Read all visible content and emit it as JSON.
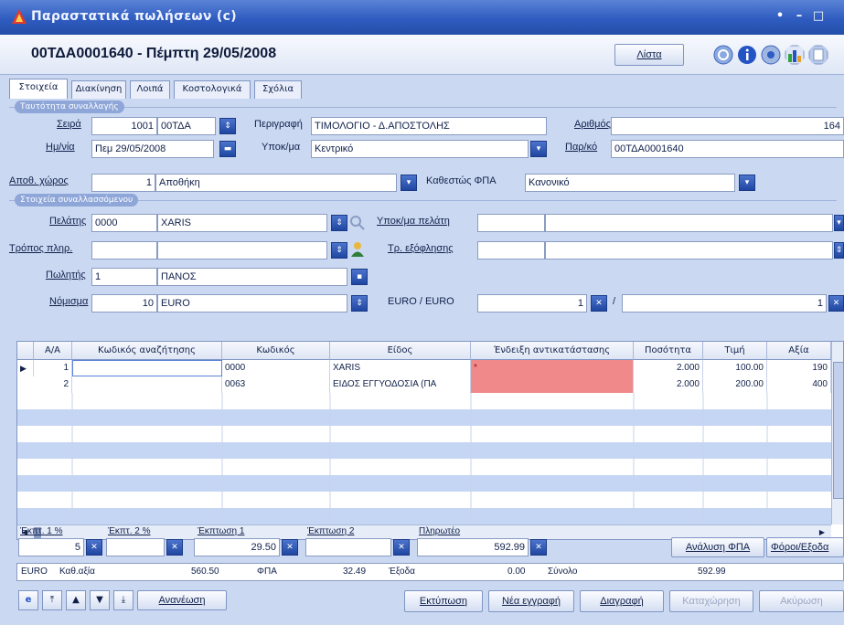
{
  "window": {
    "title": "Παραστατικά πωλήσεων (c)",
    "controls": [
      "•",
      "–",
      "□"
    ]
  },
  "header": {
    "doc_title": "00ΤΔΑ0001640 - Πέμπτη 29/05/2008",
    "list_button": "Λίστα",
    "toolbar_icons": [
      "refresh-icon",
      "info-icon",
      "settings-icon",
      "chart-icon",
      "help-icon"
    ]
  },
  "tabs": [
    {
      "label": "Στοιχεία",
      "active": true
    },
    {
      "label": "Διακίνηση",
      "active": false
    },
    {
      "label": "Λοιπά",
      "active": false
    },
    {
      "label": "Κοστολογικά",
      "active": false
    },
    {
      "label": "Σχόλια",
      "active": false
    }
  ],
  "transaction": {
    "group_label": "Ταυτότητα συναλλαγής",
    "series_label": "Σειρά",
    "series_code": "1001",
    "series_name": "00ΤΔΑ",
    "description_label": "Περιγραφή",
    "description_value": "ΤΙΜΟΛΟΓΙΟ - Δ.ΑΠΟΣΤΟΛΗΣ",
    "number_label": "Αριθμός",
    "number_value": "164",
    "date_label": "Ημ/νία",
    "date_value": "Πεμ 29/05/2008",
    "branch_label": "Υποκ/μα",
    "branch_value": "Κεντρικό",
    "docref_label": "Παρ/κό",
    "docref_value": "00ΤΔΑ0001640",
    "warehouse_label": "Αποθ. χώρος",
    "warehouse_code": "1",
    "warehouse_name": "Αποθήκη",
    "vat_label": "Καθεστώς ΦΠΑ",
    "vat_value": "Κανονικό"
  },
  "counterparty": {
    "group_label": "Στοιχεία συναλλασσόμενου",
    "customer_label": "Πελάτης",
    "customer_code": "0000",
    "customer_name": "XARIS",
    "customer_branch_label": "Υποκ/μα πελάτη",
    "customer_branch_value": "",
    "payment_label": "Τρόπος πληρ.",
    "payment_code": "",
    "payment_name": "",
    "settlement_label": "Τρ. εξόφλησης",
    "settlement_value": "",
    "seller_label": "Πωλητής",
    "seller_code": "1",
    "seller_name": "ΠΑΝΟΣ",
    "currency_label": "Νόμισμα",
    "currency_code": "10",
    "currency_name": "EURO",
    "rate_label": "EURO / EURO",
    "rate_left": "1",
    "rate_sep": "/",
    "rate_right": "1"
  },
  "grid": {
    "columns": [
      "Α/Α",
      "Κωδικός αναζήτησης",
      "Κωδικός",
      "Είδος",
      "Ένδειξη αντικατάστασης",
      "Ποσότητα",
      "Τιμή",
      "Αξία"
    ],
    "rows": [
      {
        "aa": "1",
        "search": "",
        "code": "0000",
        "item": "XARIS",
        "replace": "*",
        "qty": "2.000",
        "price": "100.00",
        "value": "190"
      },
      {
        "aa": "2",
        "search": "",
        "code": "0063",
        "item": "ΕΙΔΟΣ ΕΓΓΥΟΔΟΣΙΑ (ΠΑ",
        "replace": "",
        "qty": "2.000",
        "price": "200.00",
        "value": "400"
      }
    ],
    "highlight_color": "#f08a8a",
    "stripe_color": "#c5d6f4"
  },
  "discounts": {
    "disc1_pct_label": "Έκπτ. 1 %",
    "disc1_pct_value": "5",
    "disc2_pct_label": "Έκπτ. 2 %",
    "disc2_pct_value": "",
    "disc1_label": "Έκπτωση 1",
    "disc1_value": "29.50",
    "disc2_label": "Έκπτωση 2",
    "disc2_value": "",
    "payable_label": "Πληρωτέο",
    "payable_value": "592.99",
    "vat_analysis_button": "Ανάλυση ΦΠΑ",
    "taxes_button": "Φόροι/Εξοδα"
  },
  "summary": {
    "currency": "EURO",
    "net_label": "Καθ.αξία",
    "net_value": "560.50",
    "vat_label": "ΦΠΑ",
    "vat_value": "32.49",
    "expenses_label": "Έξοδα",
    "expenses_value": "0.00",
    "total_label": "Σύνολο",
    "total_value": "592.99"
  },
  "footer": {
    "refresh_label": "Ανανέωση",
    "print_button": "Εκτύπωση",
    "new_button": "Νέα εγγραφή",
    "delete_button": "Διαγραφή",
    "save_button": "Καταχώρηση",
    "cancel_button": "Ακύρωση"
  }
}
